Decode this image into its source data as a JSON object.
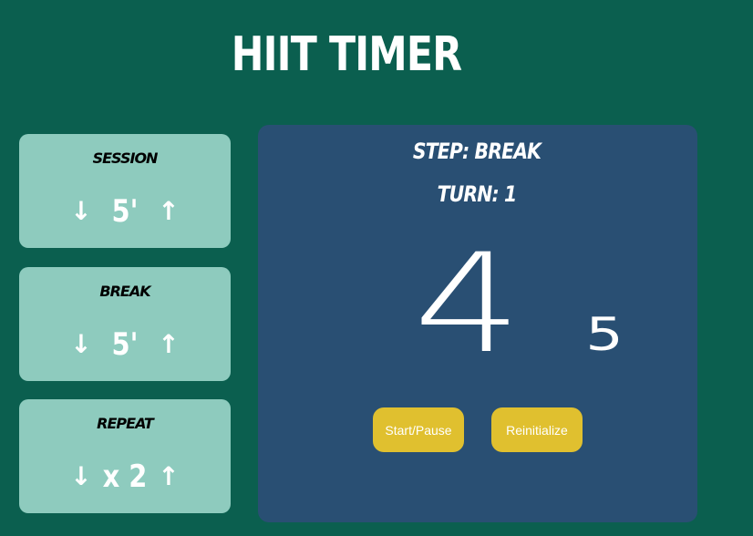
{
  "app": {
    "title": "HIIT TIMER"
  },
  "settings": [
    {
      "label": "SESSION",
      "value": "5'",
      "down_icon": "arrow-down",
      "up_icon": "arrow-up",
      "down_glyph": "↓",
      "up_glyph": "↑"
    },
    {
      "label": "BREAK",
      "value": "5'",
      "down_icon": "arrow-down",
      "up_icon": "arrow-up",
      "down_glyph": "↓",
      "up_glyph": "↑"
    },
    {
      "label": "REPEAT",
      "value": "x 2",
      "down_icon": "arrow-down",
      "up_icon": "arrow-up",
      "down_glyph": "↓",
      "up_glyph": "↑"
    }
  ],
  "timer": {
    "step_text": "STEP: BREAK",
    "turn_text": "TURN: 1",
    "main_count": "4",
    "sub_count": "5"
  },
  "buttons": {
    "start_pause": "Start/Pause",
    "reinitialize": "Reinitialize"
  },
  "colors": {
    "background": "#0b5f4f",
    "card": "#8ecbbe",
    "panel": "#294f73",
    "button": "#e0c02f"
  }
}
